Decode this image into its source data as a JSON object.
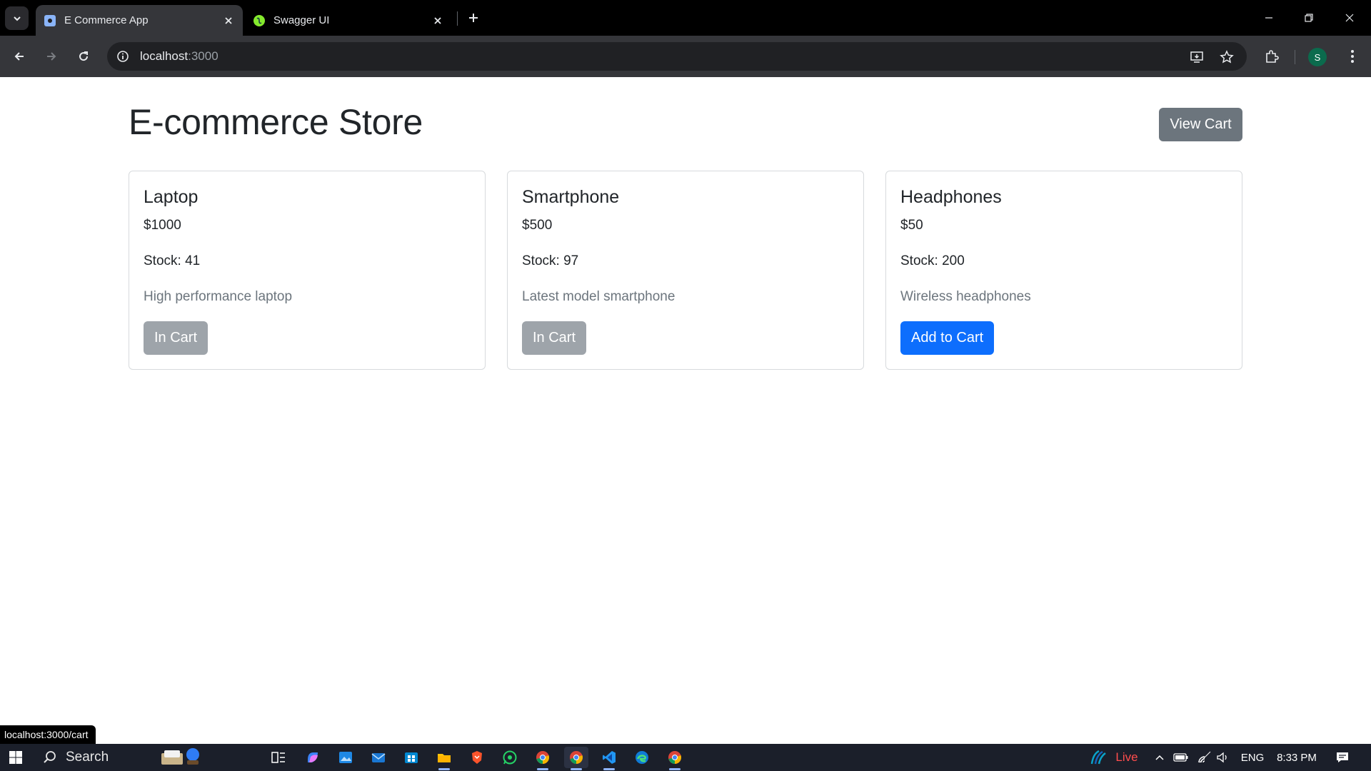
{
  "browser": {
    "tabs": [
      {
        "title": "E Commerce App",
        "active": true,
        "favicon": "react-icon"
      },
      {
        "title": "Swagger UI",
        "active": false,
        "favicon": "swagger-icon"
      }
    ],
    "url_host": "localhost",
    "url_port": ":3000",
    "profile_initial": "S",
    "status_url": "localhost:3000/cart"
  },
  "store": {
    "title": "E-commerce Store",
    "view_cart_label": "View Cart",
    "products": [
      {
        "name": "Laptop",
        "price": "$1000",
        "stock": "Stock: 41",
        "description": "High performance laptop",
        "button": "In Cart",
        "in_cart": true
      },
      {
        "name": "Smartphone",
        "price": "$500",
        "stock": "Stock: 97",
        "description": "Latest model smartphone",
        "button": "In Cart",
        "in_cart": true
      },
      {
        "name": "Headphones",
        "price": "$50",
        "stock": "Stock: 200",
        "description": "Wireless headphones",
        "button": "Add to Cart",
        "in_cart": false
      }
    ]
  },
  "taskbar": {
    "search_label": "Search",
    "live_label": "Live",
    "language": "ENG",
    "time": "8:33 PM"
  },
  "colors": {
    "primary": "#0d6efd",
    "secondary": "#6c757d",
    "disabled": "#9ea4aa"
  }
}
